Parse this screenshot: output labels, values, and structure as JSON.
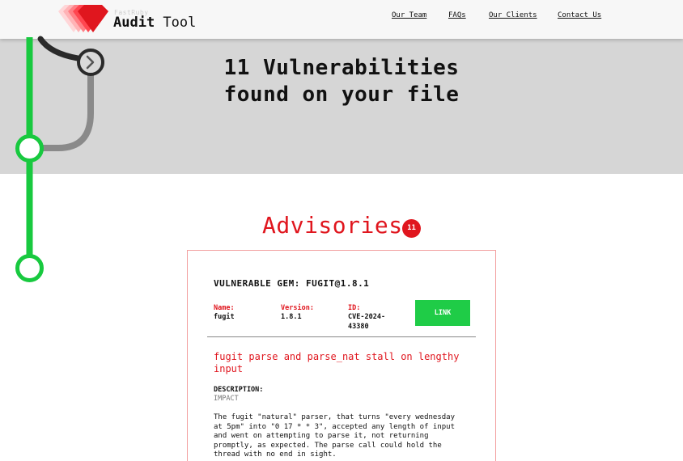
{
  "header": {
    "brand_small": "FastRuby",
    "brand_bold": "Audit",
    "brand_rest": " Tool",
    "nav": [
      "Our Team",
      "FAQs",
      "Our Clients",
      "Contact Us"
    ]
  },
  "hero": {
    "title_line1": "11 Vulnerabilities",
    "title_line2": "found on your file"
  },
  "advisories": {
    "title": "Advisories",
    "count": "11"
  },
  "card": {
    "gem_title": "VULNERABLE GEM: FUGIT@1.8.1",
    "name_label": "Name:",
    "name_value": "fugit",
    "version_label": "Version:",
    "version_value": "1.8.1",
    "id_label": "ID:",
    "id_value_line1": "CVE-2024-",
    "id_value_line2": "43380",
    "link_label": "LINK",
    "heading": "fugit parse and parse_nat stall on lengthy input",
    "description_label": "DESCRIPTION:",
    "impact": "IMPACT",
    "description": "The fugit \"natural\" parser, that turns \"every wednesday at 5pm\" into \"0 17 * * 3\", accepted any length of input and went on attempting to parse it, not returning promptly, as expected. The parse call could hold the thread with no end in sight."
  },
  "colors": {
    "accent_red": "#e0161e",
    "link_green": "#1fcc47",
    "graph_green": "#18c93f",
    "hero_bg": "#d6d6d6"
  },
  "icons": {
    "logo": "ruby-gem-logo",
    "graph_arrow": "chevron-right-icon"
  }
}
